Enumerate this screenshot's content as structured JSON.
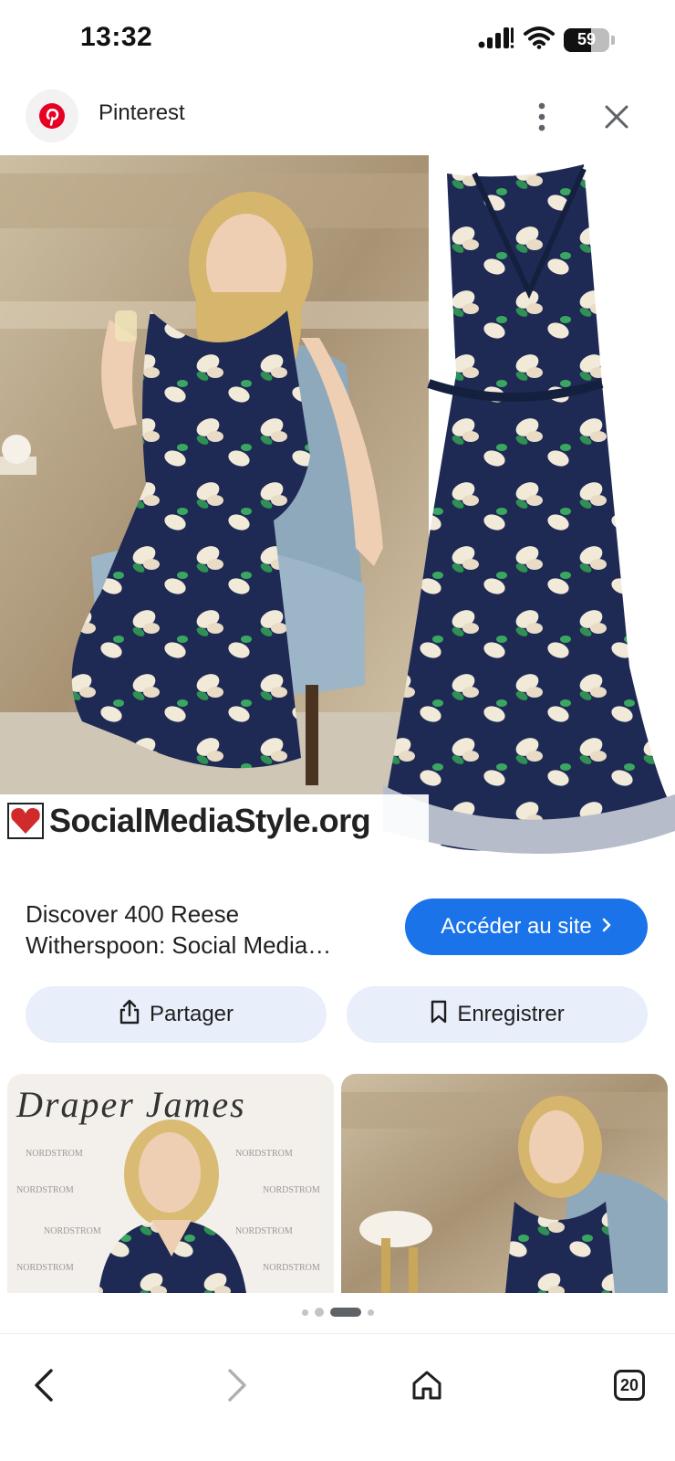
{
  "status_bar": {
    "time": "13:32",
    "battery": "59",
    "battery_level": 0.59
  },
  "header": {
    "source_name": "Pinterest",
    "icons": {
      "logo": "pinterest-logo",
      "more": "more-vert-icon",
      "close": "close-icon"
    }
  },
  "main_image": {
    "watermark": "SocialMediaStyle.org",
    "brand_color": "#e60023"
  },
  "result": {
    "title": "Discover 400 Reese Witherspoon: Social Media…",
    "visit_label": "Accéder au site",
    "share_label": "Partager",
    "save_label": "Enregistrer",
    "accent_color": "#1a73e8"
  },
  "related": {
    "thumb1_brand": "Draper James"
  },
  "bottom_nav": {
    "tab_count": "20",
    "icons": [
      "back-icon",
      "forward-icon",
      "home-icon",
      "tabs-icon"
    ]
  }
}
